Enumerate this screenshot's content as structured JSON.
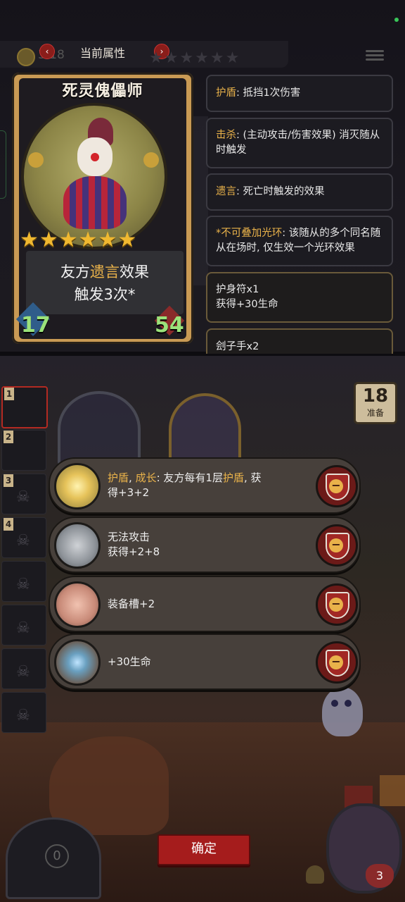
{
  "header": {
    "title": "当前属性",
    "coin_count": "3 18",
    "prev_arrow": "‹",
    "next_arrow": "›",
    "stars": "★★★★★★"
  },
  "card": {
    "name": "死灵傀儡师",
    "stars": "★★★★★★",
    "effect": {
      "prefix": "友方",
      "highlight": "遗言",
      "suffix": "效果",
      "line2": "触发3次*"
    },
    "attack": "17",
    "health": "54"
  },
  "keywords": [
    {
      "term": "护盾",
      "desc": ": 抵挡1次伤害"
    },
    {
      "term": "击杀",
      "desc": ": (主动攻击/伤害效果) 消灭随从时触发"
    },
    {
      "term": "遗言",
      "desc": ": 死亡时触发的效果"
    },
    {
      "term": "*不可叠加光环",
      "desc": ": 该随从的多个同名随从在场时, 仅生效一个光环效果"
    }
  ],
  "items": [
    {
      "name": "护身符x1",
      "effect": "获得+30生命"
    },
    {
      "name": "刽子手x2",
      "effect": ""
    }
  ],
  "roster": {
    "slots": [
      "1",
      "2",
      "3",
      "4",
      "",
      "",
      "",
      ""
    ],
    "skull": "☠"
  },
  "prep": {
    "count": "18",
    "label": "准备"
  },
  "options": [
    {
      "lines": [
        {
          "parts": [
            {
              "text": "护盾",
              "hl": true
            },
            {
              "text": ", ",
              "hl": false
            },
            {
              "text": "成长",
              "hl": true
            },
            {
              "text": ": 友方每有1层",
              "hl": false
            },
            {
              "text": "护盾",
              "hl": true
            },
            {
              "text": ", 获",
              "hl": false
            }
          ]
        },
        {
          "parts": [
            {
              "text": "得+3+2",
              "hl": false
            }
          ]
        }
      ],
      "icon": "golden-shield-icon"
    },
    {
      "lines": [
        {
          "parts": [
            {
              "text": "无法攻击",
              "hl": false
            }
          ]
        },
        {
          "parts": [
            {
              "text": "获得+2+8",
              "hl": false
            }
          ]
        }
      ],
      "icon": "spike-wall-icon"
    },
    {
      "lines": [
        {
          "parts": [
            {
              "text": "装备槽+2",
              "hl": false
            }
          ]
        }
      ],
      "icon": "pig-icon"
    },
    {
      "lines": [
        {
          "parts": [
            {
              "text": "+30生命",
              "hl": false
            }
          ]
        }
      ],
      "icon": "amulet-icon"
    }
  ],
  "remove_symbol": "−",
  "confirm_label": "确定",
  "bottom": {
    "door_count": "0",
    "hero_life": "3"
  },
  "colors": {
    "highlight": "#e9b24a",
    "confirm": "#a51c1c",
    "stat_green": "#9be27a"
  }
}
